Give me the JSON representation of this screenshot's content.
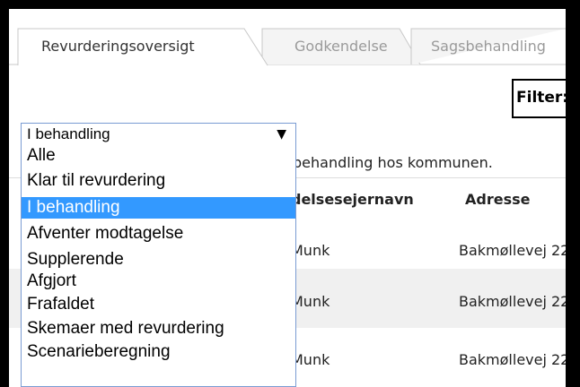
{
  "tabs": [
    {
      "label": "Revurderingsoversigt",
      "active": true
    },
    {
      "label": "Godkendelse",
      "active": false
    },
    {
      "label": "Sagsbehandling",
      "active": false
    }
  ],
  "filter": {
    "label": "Filter:"
  },
  "status_select": {
    "selected": "I behandling",
    "arrow": "▼",
    "options": [
      "Alle",
      "Klar til revurdering",
      "I behandling",
      "Afventer modtagelse",
      "Supplerende",
      "Afgjort",
      "Frafaldet",
      "Skemaer med revurdering",
      "Scenarieberegning"
    ],
    "highlighted_index": 2
  },
  "description": "behandling hos kommunen.",
  "table": {
    "headers": [
      "delsesejernavn",
      "Adresse"
    ],
    "rows": [
      [
        "Munk",
        "Bakmøllevej 22"
      ],
      [
        "Munk",
        "Bakmøllevej 22"
      ],
      [
        "Munk",
        "Bakmøllevej 22"
      ]
    ]
  },
  "colors": {
    "highlight": "#3399ff",
    "row_band": "#f0f0f0",
    "frame": "#000000"
  }
}
